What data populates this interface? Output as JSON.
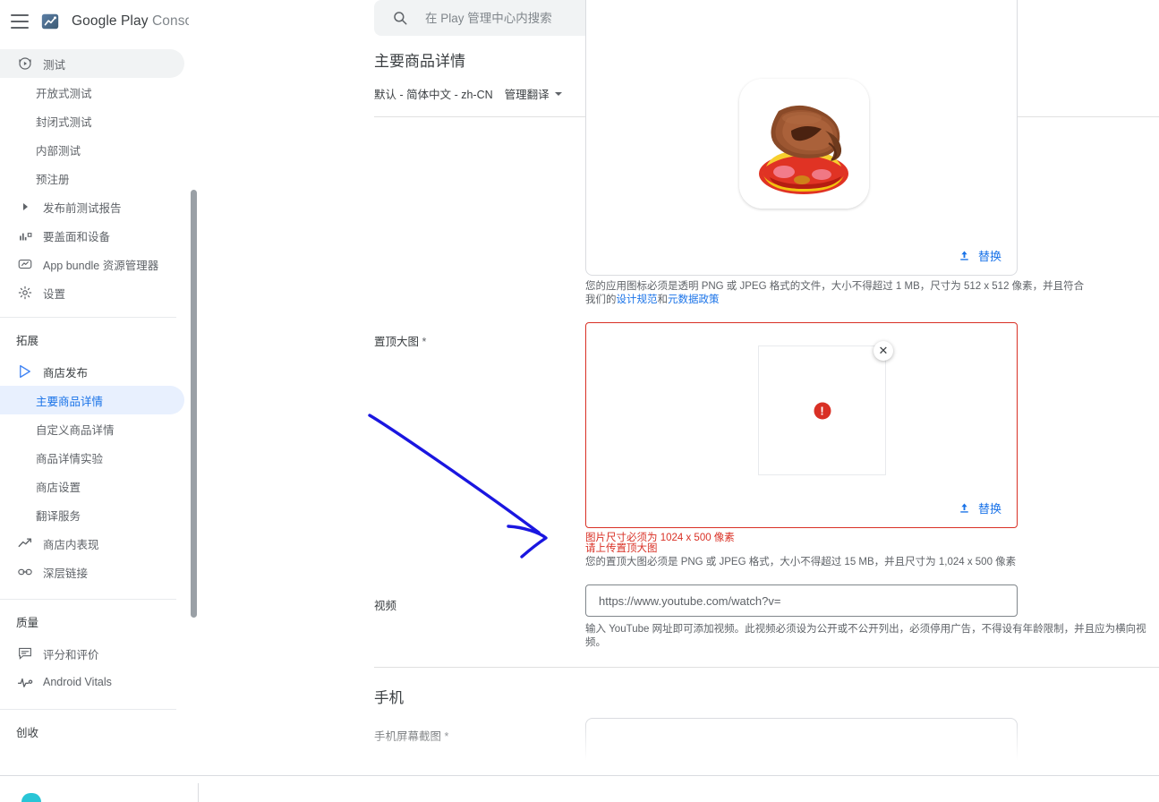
{
  "brand": {
    "name_primary": "Google Play",
    "name_secondary": "Console",
    "menu_icon": "hamburger-icon",
    "logo_icon": "google-play-console-logo"
  },
  "search": {
    "placeholder": "在 Play 管理中心内搜索",
    "value": "",
    "icon": "search-icon"
  },
  "sidebar": {
    "groups": [
      {
        "title": "",
        "items": [
          {
            "label": "测试",
            "icon": "play-circle-icon",
            "state": "active",
            "level": 0
          },
          {
            "label": "开放式测试",
            "icon": "",
            "state": "normal",
            "level": 1
          },
          {
            "label": "封闭式测试",
            "icon": "",
            "state": "normal",
            "level": 1
          },
          {
            "label": "内部测试",
            "icon": "",
            "state": "normal",
            "level": 1
          },
          {
            "label": "预注册",
            "icon": "",
            "state": "normal",
            "level": 1
          },
          {
            "label": "发布前测试报告",
            "icon": "chevron-right-icon",
            "state": "normal",
            "level": 0
          },
          {
            "label": "要盖面和设备",
            "icon": "bar-chart-icon",
            "state": "normal",
            "level": 0
          },
          {
            "label": "App bundle 资源管理器",
            "icon": "archive-icon",
            "state": "normal",
            "level": 0
          },
          {
            "label": "设置",
            "icon": "gear-icon",
            "state": "normal",
            "level": 0
          }
        ]
      },
      {
        "title": "拓展",
        "items": [
          {
            "label": "商店发布",
            "icon": "play-triangle-icon",
            "state": "parent",
            "level": 0
          },
          {
            "label": "主要商品详情",
            "icon": "",
            "state": "selected",
            "level": 1
          },
          {
            "label": "自定义商品详情",
            "icon": "",
            "state": "normal",
            "level": 1
          },
          {
            "label": "商品详情实验",
            "icon": "",
            "state": "normal",
            "level": 1
          },
          {
            "label": "商店设置",
            "icon": "",
            "state": "normal",
            "level": 1
          },
          {
            "label": "翻译服务",
            "icon": "",
            "state": "normal",
            "level": 1
          },
          {
            "label": "商店内表现",
            "icon": "trending-up-icon",
            "state": "normal",
            "level": 0
          },
          {
            "label": "深层链接",
            "icon": "link-icon",
            "state": "normal",
            "level": 0
          }
        ]
      },
      {
        "title": "质量",
        "items": [
          {
            "label": "评分和评价",
            "icon": "review-icon",
            "state": "normal",
            "level": 0
          },
          {
            "label": "Android Vitals",
            "icon": "vitals-icon",
            "state": "normal",
            "level": 0
          }
        ]
      },
      {
        "title": "创收",
        "items": []
      }
    ]
  },
  "page": {
    "title": "主要商品详情",
    "language": "默认 - 简体中文 - zh-CN",
    "manage_translations": "管理翻译"
  },
  "app_icon": {
    "replace_label": "替换",
    "replace_icon": "upload-icon",
    "helper_text_1": "您的应用图标必须是透明 PNG 或 JPEG 格式的文件，大小不得超过 1 MB，尺寸为 512 x 512 像素，并且符合",
    "helper_text_2_prefix": "我们的",
    "helper_link_1": "设计规范",
    "helper_text_2_mid": "和",
    "helper_link_2": "元数据政策"
  },
  "feature_graphic": {
    "label": "置顶大图",
    "required_mark": "*",
    "error_icon": "error-exclamation-icon",
    "close_icon": "close-icon",
    "replace_label": "替换",
    "replace_icon": "upload-icon",
    "error_1": "图片尺寸必须为 1024 x 500 像素",
    "error_2": "请上传置顶大图",
    "helper": "您的置顶大图必须是 PNG 或 JPEG 格式，大小不得超过 15 MB，并且尺寸为 1,024 x 500 像素"
  },
  "video": {
    "label": "视频",
    "placeholder": "https://www.youtube.com/watch?v=",
    "value": "",
    "helper": "输入 YouTube 网址即可添加视频。此视频必须设为公开或不公开列出，必须停用广告，不得设有年龄限制，并且应为横向视频。"
  },
  "phone_section": {
    "heading": "手机",
    "field_label": "手机屏幕截图",
    "required_mark": "*"
  },
  "annotation": {
    "type": "hand-drawn-arrow",
    "color": "#1a16e0"
  },
  "colors": {
    "accent_blue": "#1a73e8",
    "error_red": "#d93025",
    "selected_bg": "#e8f0fe",
    "text_primary": "#3c4043",
    "text_secondary": "#5f6368",
    "annotation_blue": "#1a16e0"
  }
}
